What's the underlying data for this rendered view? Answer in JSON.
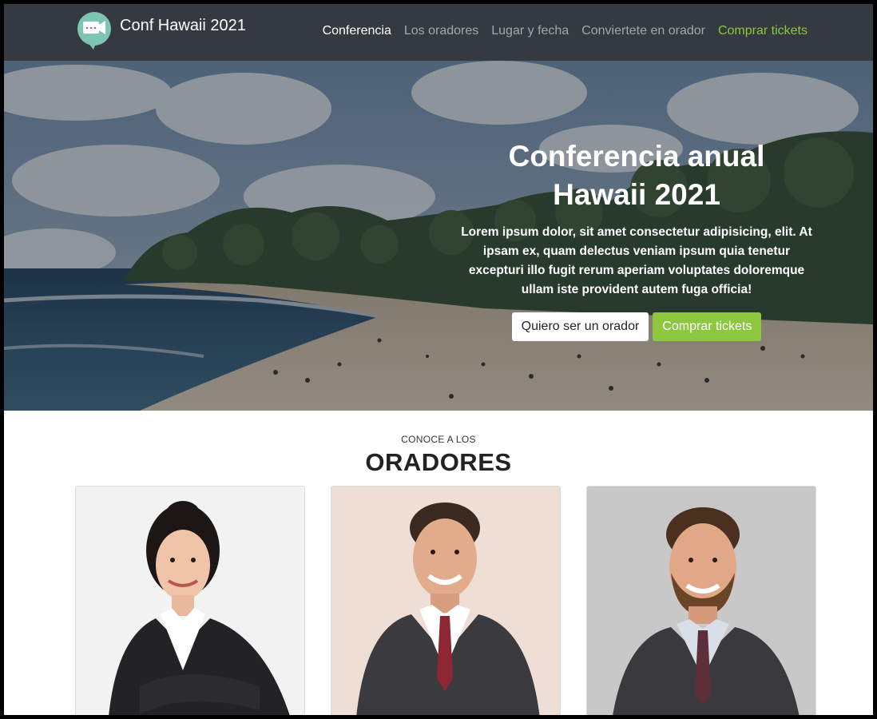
{
  "navbar": {
    "brand": "Conf Hawaii 2021",
    "links": [
      {
        "label": "Conferencia",
        "state": "active"
      },
      {
        "label": "Los oradores",
        "state": "normal"
      },
      {
        "label": "Lugar y fecha",
        "state": "normal"
      },
      {
        "label": "Conviertete en orador",
        "state": "normal"
      },
      {
        "label": "Comprar tickets",
        "state": "cta"
      }
    ]
  },
  "hero": {
    "title_line1": "Conferencia anual",
    "title_line2": "Hawaii 2021",
    "text": "Lorem ipsum dolor, sit amet consectetur adipisicing, elit. At ipsam ex, quam delectus veniam ipsum quia tenetur excepturi illo fugit rerum aperiam voluptates doloremque ullam iste provident autem fuga officia!",
    "primary_button": "Quiero ser un orador",
    "secondary_button": "Comprar tickets"
  },
  "speakers": {
    "kicker": "CONOCE A LOS",
    "title": "ORADORES"
  },
  "colors": {
    "navbar_bg": "#343a40",
    "accent_green": "#8dc63f"
  }
}
